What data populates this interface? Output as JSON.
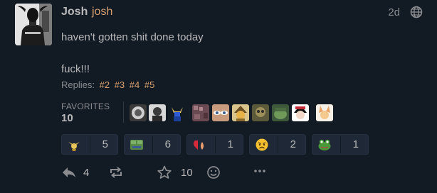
{
  "post": {
    "display_name": "Josh",
    "handle": "josh",
    "time": "2d",
    "content_line1": "haven't gotten shit done today",
    "content_line2": "fuck!!!",
    "replies_label": "Replies:",
    "replies": [
      "#2",
      "#3",
      "#4",
      "#5"
    ],
    "favorites_label": "FAVORITES",
    "favorites_count": "10"
  },
  "reactions": [
    {
      "emoji": "military-badge-emoji",
      "count": "5"
    },
    {
      "emoji": "pepe-frog-emoji",
      "count": "6"
    },
    {
      "emoji": "heart-drop-emoji",
      "count": "1"
    },
    {
      "emoji": "angry-face-emoji",
      "count": "2"
    },
    {
      "emoji": "frog-emoji",
      "count": "1"
    }
  ],
  "actions": {
    "reply_count": "4",
    "favorite_count": "10"
  },
  "icons": {
    "globe": "globe-icon",
    "reply": "reply-icon",
    "repeat": "repeat-icon",
    "favorite": "star-icon",
    "react": "smiley-icon",
    "more": "more-icon"
  },
  "colors": {
    "background": "#121a24",
    "text": "#b9b9ba",
    "accent": "#d8a070",
    "muted": "#8a8c8f",
    "reaction_bg": "#1e2836"
  }
}
